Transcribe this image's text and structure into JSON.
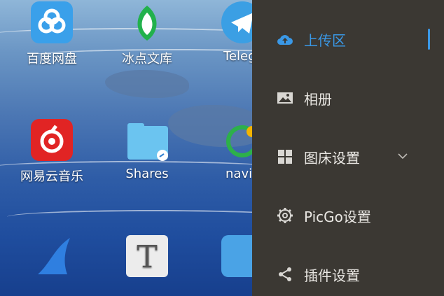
{
  "desktop": {
    "apps": [
      {
        "label": "百度网盘"
      },
      {
        "label": "冰点文库"
      },
      {
        "label": "Telegr"
      },
      {
        "label": "网易云音乐"
      },
      {
        "label": "Shares"
      },
      {
        "label": "navic"
      },
      {
        "label": ""
      },
      {
        "label": ""
      },
      {
        "label": ""
      }
    ]
  },
  "sidebar": {
    "items": [
      {
        "label": "上传区",
        "icon": "cloud-upload-icon",
        "active": true
      },
      {
        "label": "相册",
        "icon": "image-icon"
      },
      {
        "label": "图床设置",
        "icon": "grid-icon"
      },
      {
        "label": "PicGo设置",
        "icon": "gear-icon"
      },
      {
        "label": "插件设置",
        "icon": "share-icon"
      }
    ],
    "accent": "#3a98e6",
    "background": "#3b3833"
  }
}
